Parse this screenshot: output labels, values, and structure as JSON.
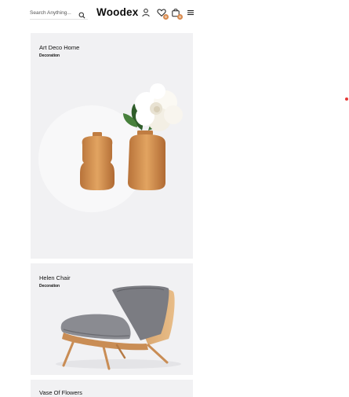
{
  "header": {
    "search_placeholder": "Search Anything...",
    "brand": "Woodex",
    "wishlist_count": "0",
    "cart_count": "0"
  },
  "products": [
    {
      "title": "Art Deco Home",
      "category": "Decoration"
    },
    {
      "title": "Helen Chair",
      "category": "Decoration"
    },
    {
      "title": "Vase Of Flowers",
      "category": ""
    }
  ],
  "colors": {
    "card_background": "#f1f1f3",
    "badge": "#d88a4e",
    "accent_dot": "#e53935"
  }
}
